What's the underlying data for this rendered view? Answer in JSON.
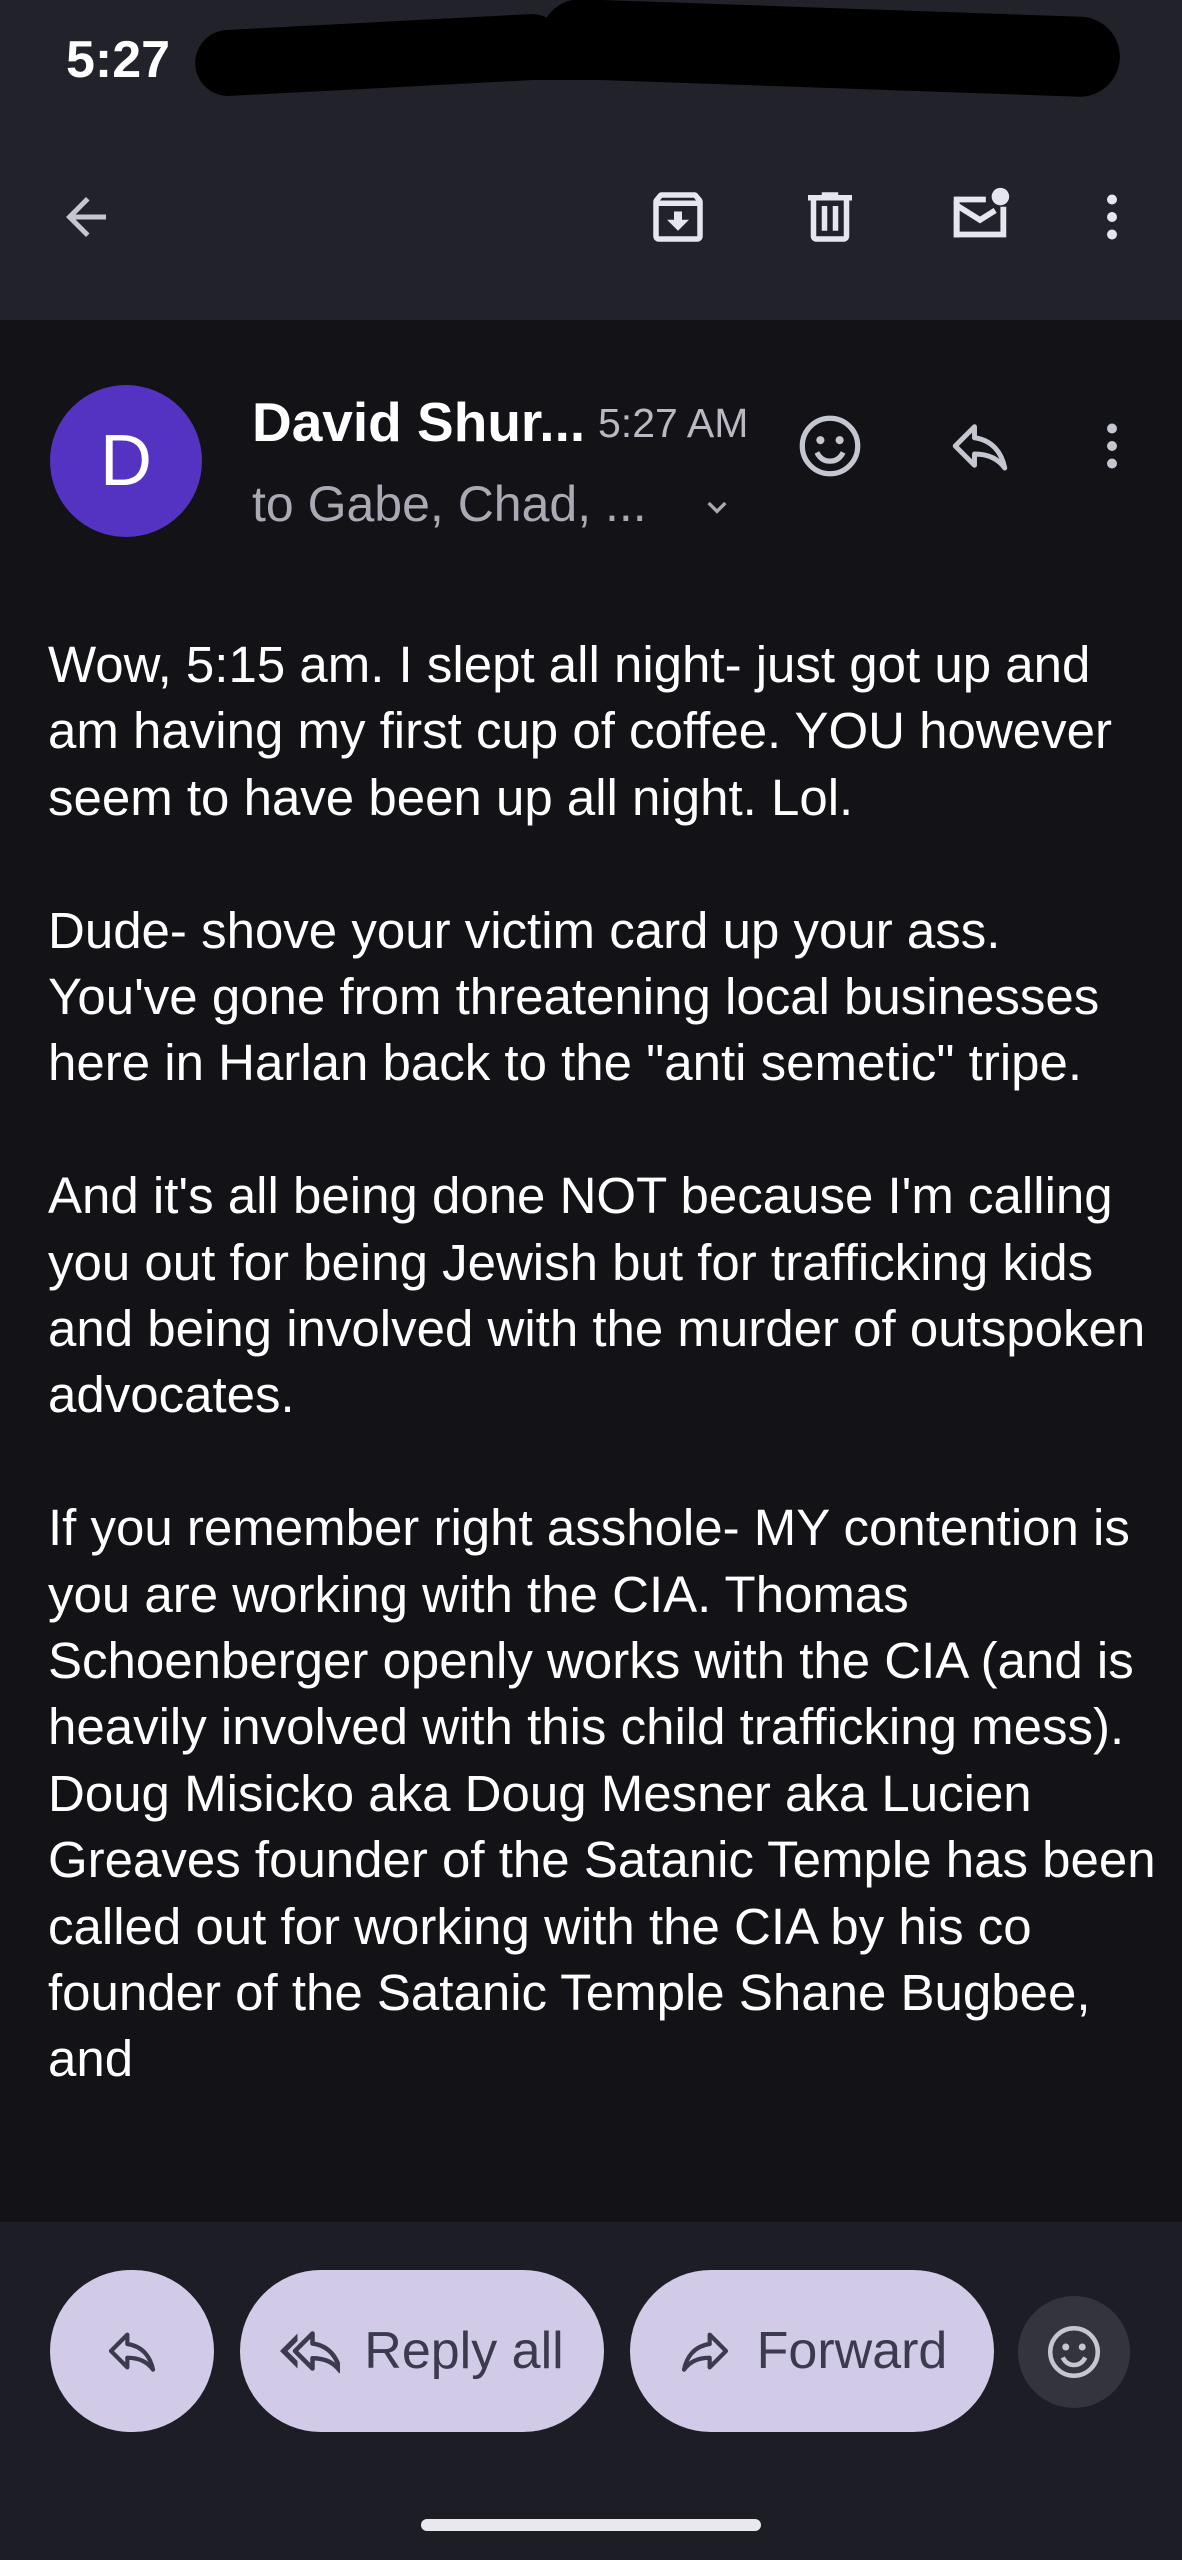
{
  "status_bar": {
    "time": "5:27"
  },
  "toolbar": {
    "icons": [
      "arrow-back-icon",
      "archive-icon",
      "trash-icon",
      "mark-unread-icon",
      "more-vert-icon"
    ]
  },
  "message": {
    "avatar_letter": "D",
    "avatar_color": "#5533c2",
    "sender": "David Shur...",
    "time": "5:27 AM",
    "recipients": "to Gabe, Chad, ...",
    "paragraphs": [
      "Wow, 5:15 am. I slept all night- just got up and am having my first cup of coffee. YOU however seem to have been up all night. Lol.",
      "Dude- shove your victim card up your ass. You've gone from threatening local businesses here in Harlan back to the \"anti semetic\" tripe.",
      "And it's all being done NOT because I'm calling you out for being Jewish but for trafficking kids and being involved with the murder of outspoken advocates.",
      "If you remember right asshole- MY contention is you are working with the CIA. Thomas Schoenberger openly works with the CIA (and is heavily involved with this child trafficking mess). Doug Misicko aka Doug Mesner aka Lucien Greaves founder of the Satanic Temple has been called out for working with the CIA by his co founder of the Satanic Temple Shane Bugbee, and"
    ]
  },
  "actions": {
    "reply_all": "Reply all",
    "forward": "Forward"
  },
  "colors": {
    "background": "#121217",
    "app_bar": "#22232a",
    "pill": "#d1cbe8"
  }
}
